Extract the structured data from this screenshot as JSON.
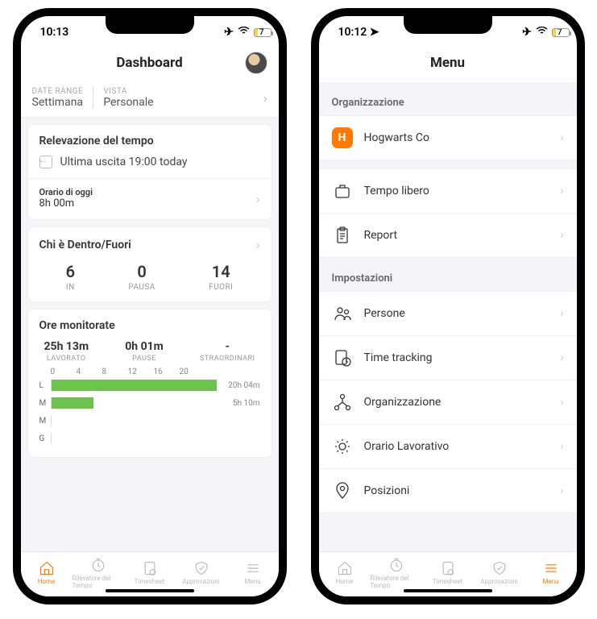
{
  "status": {
    "time_left": "10:13",
    "time_right": "10:12",
    "battery_pct": 7
  },
  "dash": {
    "title": "Dashboard",
    "filters": {
      "range_label": "DATE RANGE",
      "range_value": "Settimana",
      "view_label": "VISTA",
      "view_value": "Personale"
    },
    "tracking": {
      "title": "Relevazione del tempo",
      "last_out": "Ultima uscita 19:00 today",
      "today_label": "Orario di oggi",
      "today_value": "8h 00m"
    },
    "who": {
      "title": "Chi è Dentro/Fuori",
      "in_value": "6",
      "in_label": "IN",
      "pause_value": "0",
      "pause_label": "PAUSA",
      "out_value": "14",
      "out_label": "FUORI"
    },
    "hours": {
      "title": "Ore monitorate",
      "worked_value": "25h 13m",
      "worked_label": "LAVORATO",
      "pause_value": "0h 01m",
      "pause_label": "PAUSE",
      "ot_value": "-",
      "ot_label": "STRAORDINARI"
    }
  },
  "chart_data": {
    "type": "bar",
    "orientation": "horizontal",
    "xlabel": "",
    "ylabel": "",
    "xlim": [
      0,
      20
    ],
    "ticks": [
      "0",
      "4",
      "8",
      "12",
      "16",
      "20"
    ],
    "categories": [
      "L",
      "M",
      "M",
      "G"
    ],
    "values": [
      20.07,
      5.17,
      0,
      0
    ],
    "value_labels": [
      "20h 04m",
      "5h 10m",
      "",
      ""
    ]
  },
  "menu": {
    "title": "Menu",
    "section1": "Organizzazione",
    "org_name": "Hogwarts Co",
    "org_letter": "H",
    "item_timeoff": "Tempo libero",
    "item_report": "Report",
    "section2": "Impostazioni",
    "item_people": "Persone",
    "item_timetracking": "Time tracking",
    "item_org": "Organizzazione",
    "item_schedule": "Orario Lavorativo",
    "item_positions": "Posizioni"
  },
  "tabs": {
    "home": "Home",
    "tracker": "Rilevatore del Tempo",
    "timesheet": "Timesheet",
    "approvals": "Approvazioni",
    "menu": "Menu"
  }
}
